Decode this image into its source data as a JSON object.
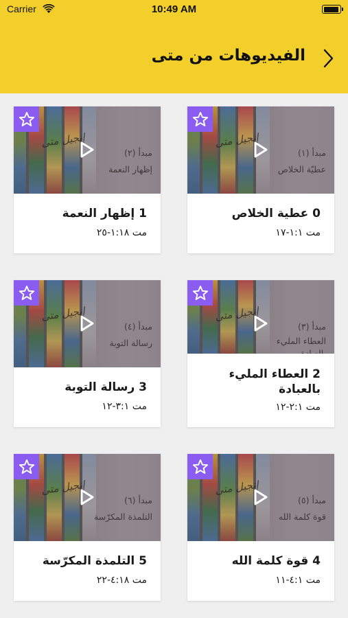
{
  "status_bar": {
    "carrier": "Carrier",
    "time": "10:49 AM",
    "battery_level": 0.95
  },
  "header": {
    "title": "الفيديوهات من متى"
  },
  "colors": {
    "accent": "#f3cf2c",
    "star_bg": "#8a5cf0",
    "card_bg": "#ffffff",
    "page_bg": "#efefef"
  },
  "cards": [
    {
      "overlay_line1": "مبدأ (١)",
      "overlay_line2": "عطيّة الخلاص",
      "overlay_line3": "",
      "title": "0 عطية الخلاص",
      "reference": "مت ١:١-١٧"
    },
    {
      "overlay_line1": "مبدأ (٢)",
      "overlay_line2": "إظهار النعمة",
      "overlay_line3": "",
      "title": "1 إظهار النعمة",
      "reference": "مت ١:١٨-٢٥"
    },
    {
      "overlay_line1": "مبدأ (٣)",
      "overlay_line2": "العطاء المليء",
      "overlay_line3": "بالعبادة",
      "title": "2 العطاء المليء بالعبادة",
      "reference": "مت ٢:١-١٢"
    },
    {
      "overlay_line1": "مبدأ (٤)",
      "overlay_line2": "رسالة التوبة",
      "overlay_line3": "",
      "title": "3 رسالة التوبة",
      "reference": "مت ٣:١-١٢"
    },
    {
      "overlay_line1": "مبدأ (٥)",
      "overlay_line2": "قوة كلمة الله",
      "overlay_line3": "",
      "title": "4 قوة كلمة الله",
      "reference": "مت ٤:١-١١"
    },
    {
      "overlay_line1": "مبدأ (٦)",
      "overlay_line2": "التلمذة المكرّسة",
      "overlay_line3": "",
      "title": "5 التلمذة المكرّسة",
      "reference": "مت ٤:١٨-٢٢"
    }
  ],
  "thumbnail_script_text": "إنجيل متى"
}
